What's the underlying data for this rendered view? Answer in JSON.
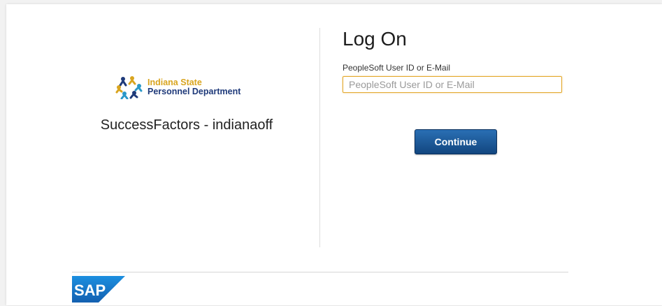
{
  "branding": {
    "org_line1": "Indiana State",
    "org_line2": "Personnel Department",
    "company": "SuccessFactors - indianaoff",
    "vendor_logo_text": "SAP",
    "colors": {
      "gold": "#d9a520",
      "navy": "#1f3a7a",
      "teal": "#2a98c8",
      "sap_blue": "#1670c2"
    }
  },
  "login": {
    "title": "Log On",
    "field_label": "PeopleSoft User ID or E-Mail",
    "field_placeholder": "PeopleSoft User ID or E-Mail",
    "field_value": "",
    "continue_label": "Continue",
    "colors": {
      "input_focus_border": "#e3a82b",
      "button_top": "#2a6fb4",
      "button_bottom": "#12467f"
    }
  }
}
